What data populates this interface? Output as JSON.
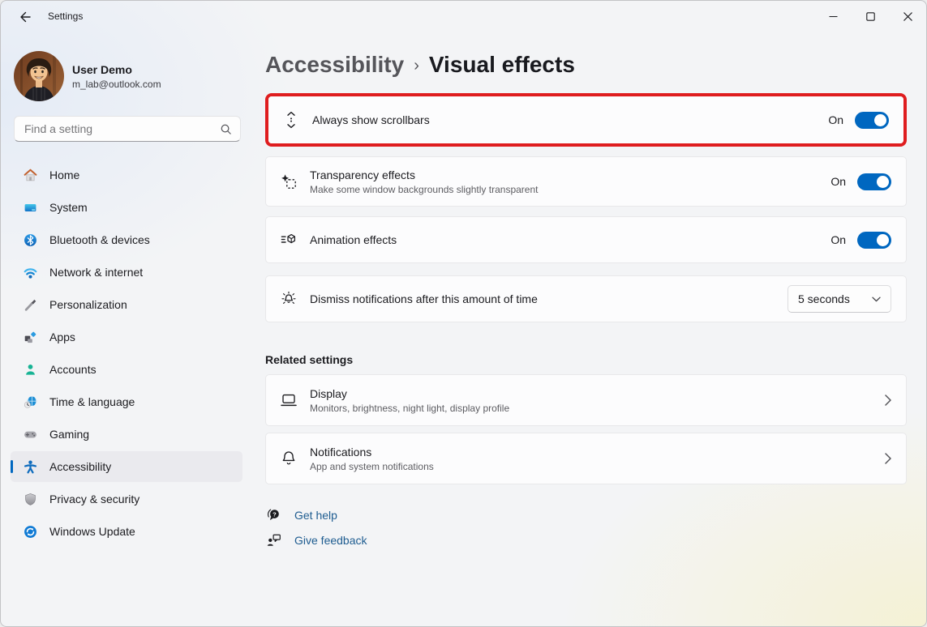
{
  "titlebar": {
    "app_title": "Settings"
  },
  "sidebar": {
    "user": {
      "name": "User Demo",
      "email": "m_lab@outlook.com"
    },
    "search": {
      "placeholder": "Find a setting"
    },
    "items": [
      {
        "label": "Home"
      },
      {
        "label": "System"
      },
      {
        "label": "Bluetooth & devices"
      },
      {
        "label": "Network & internet"
      },
      {
        "label": "Personalization"
      },
      {
        "label": "Apps"
      },
      {
        "label": "Accounts"
      },
      {
        "label": "Time & language"
      },
      {
        "label": "Gaming"
      },
      {
        "label": "Accessibility",
        "selected": true
      },
      {
        "label": "Privacy & security"
      },
      {
        "label": "Windows Update"
      }
    ]
  },
  "main": {
    "breadcrumb": {
      "parent": "Accessibility",
      "separator": "›",
      "current": "Visual effects"
    },
    "settings": [
      {
        "label": "Always show scrollbars",
        "status": "On",
        "highlighted": true
      },
      {
        "label": "Transparency effects",
        "description": "Make some window backgrounds slightly transparent",
        "status": "On"
      },
      {
        "label": "Animation effects",
        "status": "On"
      },
      {
        "label": "Dismiss notifications after this amount of time",
        "value": "5 seconds"
      }
    ],
    "related": {
      "header": "Related settings",
      "items": [
        {
          "label": "Display",
          "description": "Monitors, brightness, night light, display profile"
        },
        {
          "label": "Notifications",
          "description": "App and system notifications"
        }
      ]
    },
    "links": [
      {
        "label": "Get help"
      },
      {
        "label": "Give feedback"
      }
    ]
  },
  "colors": {
    "accent": "#0067c0",
    "highlight_border": "#df1d1f",
    "link": "#1e5c90"
  }
}
